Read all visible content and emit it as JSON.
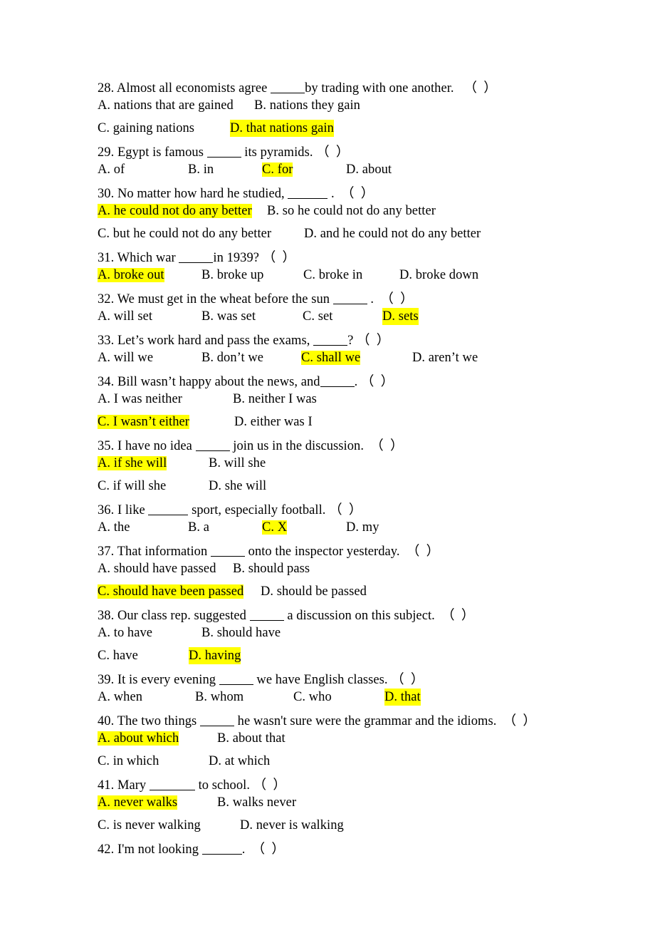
{
  "document": {
    "type": "grammar-multiple-choice-worksheet",
    "highlight_color": "#ffff00",
    "text_color": "#000000",
    "background_color": "#ffffff",
    "answer_marker": "（  ）"
  },
  "questions": [
    {
      "number": "28.",
      "stem_before": "28. Almost all economists agree ",
      "stem_after": "by trading with one another.",
      "marker": "（  ）",
      "rows": [
        [
          {
            "label": "A.",
            "text": "A. nations that are gained",
            "highlight": false
          },
          {
            "label": "B.",
            "text": "B. nations they gain",
            "highlight": false
          }
        ],
        [
          {
            "label": "C.",
            "text": "C. gaining nations",
            "highlight": false
          },
          {
            "label": "D.",
            "text": "D. that nations gain",
            "highlight": true
          }
        ]
      ]
    },
    {
      "number": "29.",
      "stem_before": "29. Egypt is famous ",
      "stem_after": " its pyramids.",
      "marker": "（  ）",
      "rows": [
        [
          {
            "label": "A.",
            "text": "A. of",
            "highlight": false
          },
          {
            "label": "B.",
            "text": "B. in",
            "highlight": false
          },
          {
            "label": "C.",
            "text": "C. for",
            "highlight": true
          },
          {
            "label": "D.",
            "text": "D. about",
            "highlight": false
          }
        ]
      ]
    },
    {
      "number": "30.",
      "stem_before": "30. No matter how hard he studied, ",
      "stem_after": " .",
      "marker": "（  ）",
      "rows": [
        [
          {
            "label": "A.",
            "text": "A. he could not do any better",
            "highlight": true
          },
          {
            "label": "B.",
            "text": "B. so he could not do any better",
            "highlight": false
          }
        ],
        [
          {
            "label": "C.",
            "text": "C. but he could not do any better",
            "highlight": false
          },
          {
            "label": "D.",
            "text": "D. and he could not do any better",
            "highlight": false
          }
        ]
      ]
    },
    {
      "number": "31.",
      "stem_before": "31. Which war ",
      "stem_after": "in 1939?",
      "marker": "（  ）",
      "rows": [
        [
          {
            "label": "A.",
            "text": "A. broke out",
            "highlight": true
          },
          {
            "label": "B.",
            "text": "B. broke up",
            "highlight": false
          },
          {
            "label": "C.",
            "text": "C. broke in",
            "highlight": false
          },
          {
            "label": "D.",
            "text": "D. broke down",
            "highlight": false
          }
        ]
      ]
    },
    {
      "number": "32.",
      "stem_before": "32. We must get in the wheat before the sun ",
      "stem_after": " .",
      "marker": "（  ）",
      "rows": [
        [
          {
            "label": "A.",
            "text": "A. will set",
            "highlight": false
          },
          {
            "label": "B.",
            "text": "B. was set",
            "highlight": false
          },
          {
            "label": "C.",
            "text": "C. set",
            "highlight": false
          },
          {
            "label": "D.",
            "text": "D. sets",
            "highlight": true
          }
        ]
      ]
    },
    {
      "number": "33.",
      "stem_before": "33. Let’s work hard and pass the exams, ",
      "stem_after": "?",
      "marker": "（  ）",
      "rows": [
        [
          {
            "label": "A.",
            "text": "A. will we",
            "highlight": false
          },
          {
            "label": "B.",
            "text": "B. don’t we",
            "highlight": false
          },
          {
            "label": "C.",
            "text": "C. shall we",
            "highlight": true
          },
          {
            "label": "D.",
            "text": "D. aren’t we",
            "highlight": false
          }
        ]
      ]
    },
    {
      "number": "34.",
      "stem_before": "34. Bill wasn’t happy about the news, and",
      "stem_after": ".",
      "marker": "（  ）",
      "rows": [
        [
          {
            "label": "A.",
            "text": "A. I was neither",
            "highlight": false
          },
          {
            "label": "B.",
            "text": "B. neither I was",
            "highlight": false
          }
        ],
        [
          {
            "label": "C.",
            "text": "C. I wasn’t either",
            "highlight": true
          },
          {
            "label": "D.",
            "text": "D. either was I",
            "highlight": false
          }
        ]
      ]
    },
    {
      "number": "35.",
      "stem_before": "35. I have no idea ",
      "stem_after": " join us in the discussion.",
      "marker": "（  ）",
      "rows": [
        [
          {
            "label": "A.",
            "text": "A. if she will",
            "highlight": true
          },
          {
            "label": "B.",
            "text": "B. will she",
            "highlight": false
          }
        ],
        [
          {
            "label": "C.",
            "text": "C. if will she",
            "highlight": false
          },
          {
            "label": "D.",
            "text": "D. she will",
            "highlight": false
          }
        ]
      ]
    },
    {
      "number": "36.",
      "stem_before": "36. I like ",
      "stem_after": " sport, especially football.",
      "marker": "（  ）",
      "rows": [
        [
          {
            "label": "A.",
            "text": "A. the",
            "highlight": false
          },
          {
            "label": "B.",
            "text": "B. a",
            "highlight": false
          },
          {
            "label": "C.",
            "text": "C. X",
            "highlight": true
          },
          {
            "label": "D.",
            "text": "D. my",
            "highlight": false
          }
        ]
      ]
    },
    {
      "number": "37.",
      "stem_before": "37. That information ",
      "stem_after": " onto the inspector yesterday.",
      "marker": "（  ）",
      "rows": [
        [
          {
            "label": "A.",
            "text": "A. should have passed",
            "highlight": false
          },
          {
            "label": "B.",
            "text": "B. should pass",
            "highlight": false
          }
        ],
        [
          {
            "label": "C.",
            "text": "C. should have been passed",
            "highlight": true
          },
          {
            "label": "D.",
            "text": "D. should be passed",
            "highlight": false
          }
        ]
      ]
    },
    {
      "number": "38.",
      "stem_before": "38. Our class rep. suggested ",
      "stem_after": " a discussion on this subject.",
      "marker": "（  ）",
      "rows": [
        [
          {
            "label": "A.",
            "text": "A. to have",
            "highlight": false
          },
          {
            "label": "B.",
            "text": "B. should have",
            "highlight": false
          }
        ],
        [
          {
            "label": "C.",
            "text": "C. have",
            "highlight": false
          },
          {
            "label": "D.",
            "text": "D. having",
            "highlight": true
          }
        ]
      ]
    },
    {
      "number": "39.",
      "stem_before": "39. It is every evening ",
      "stem_after": " we have English classes.",
      "marker": "（  ）",
      "rows": [
        [
          {
            "label": "A.",
            "text": "A. when",
            "highlight": false
          },
          {
            "label": "B.",
            "text": "B. whom",
            "highlight": false
          },
          {
            "label": "C.",
            "text": "C. who",
            "highlight": false
          },
          {
            "label": "D.",
            "text": "D. that",
            "highlight": true
          }
        ]
      ]
    },
    {
      "number": "40.",
      "stem_before": "40. The two things ",
      "stem_after": " he wasn't sure were the grammar and the idioms.",
      "marker": "（  ）",
      "rows": [
        [
          {
            "label": "A.",
            "text": "A. about which",
            "highlight": true
          },
          {
            "label": "B.",
            "text": "B. about that",
            "highlight": false
          }
        ],
        [
          {
            "label": "C.",
            "text": "C. in which",
            "highlight": false
          },
          {
            "label": "D.",
            "text": "D. at which",
            "highlight": false
          }
        ]
      ]
    },
    {
      "number": "41.",
      "stem_before": "41. Mary ",
      "stem_after": " to school.",
      "marker": "（  ）",
      "rows": [
        [
          {
            "label": "A.",
            "text": "A. never walks",
            "highlight": true
          },
          {
            "label": "B.",
            "text": "B. walks never",
            "highlight": false
          }
        ],
        [
          {
            "label": "C.",
            "text": "C. is never walking",
            "highlight": false
          },
          {
            "label": "D.",
            "text": "D. never is walking",
            "highlight": false
          }
        ]
      ]
    },
    {
      "number": "42.",
      "stem_before": "42. I'm not looking ",
      "stem_after": ".",
      "marker": "（  ）",
      "rows": []
    }
  ]
}
